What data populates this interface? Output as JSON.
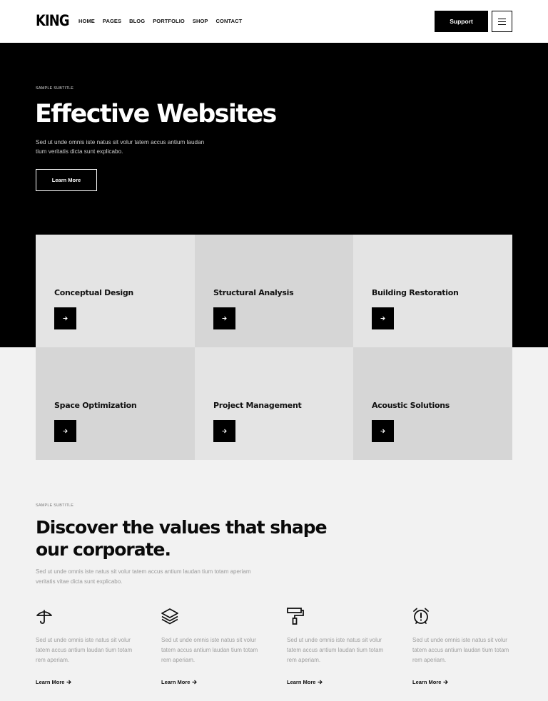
{
  "header": {
    "logo": "KING",
    "nav": [
      "HOME",
      "PAGES",
      "BLOG",
      "PORTFOLIO",
      "SHOP",
      "CONTACT"
    ],
    "support_label": "Support",
    "menu_icon": "hamburger-icon"
  },
  "hero": {
    "subtitle": "SAMPLE SUBTITLE",
    "title": "Effective Websites",
    "description": "Sed ut unde omnis iste natus sit volur tatem accus antium laudan tium veritatis dicta sunt explicabo.",
    "button_label": "Learn More"
  },
  "services": [
    {
      "title": "Conceptual Design",
      "icon": "arrow-right-icon"
    },
    {
      "title": "Structural Analysis",
      "icon": "arrow-right-icon"
    },
    {
      "title": "Building Restoration",
      "icon": "arrow-right-icon"
    },
    {
      "title": "Space Optimization",
      "icon": "arrow-right-icon"
    },
    {
      "title": "Project Management",
      "icon": "arrow-right-icon"
    },
    {
      "title": "Acoustic Solutions",
      "icon": "arrow-right-icon"
    }
  ],
  "values": {
    "subtitle": "SAMPLE SUBTITLE",
    "title": "Discover the values that shape our corporate.",
    "description": "Sed ut unde omnis iste natus sit volur tatem accus antium laudan tium totam aperiam veritatis vitae dicta sunt explicabo.",
    "features": [
      {
        "icon": "umbrella-icon",
        "text": "Sed ut unde omnis iste natus sit volur tatem accus antium laudan tium totam rem aperiam.",
        "link": "Learn More"
      },
      {
        "icon": "layers-icon",
        "text": "Sed ut unde omnis iste natus sit volur tatem accus antium laudan tium totam rem aperiam.",
        "link": "Learn More"
      },
      {
        "icon": "paint-roller-icon",
        "text": "Sed ut unde omnis iste natus sit volur tatem accus antium laudan tium totam rem aperiam.",
        "link": "Learn More"
      },
      {
        "icon": "alarm-clock-icon",
        "text": "Sed ut unde omnis iste natus sit volur tatem accus antium laudan tium totam rem aperiam.",
        "link": "Learn More"
      }
    ]
  },
  "colors": {
    "primary": "#000000",
    "card_light": "#e4e4e4",
    "card_mid": "#d6d6d6",
    "page_bg": "#f2f2f2"
  }
}
